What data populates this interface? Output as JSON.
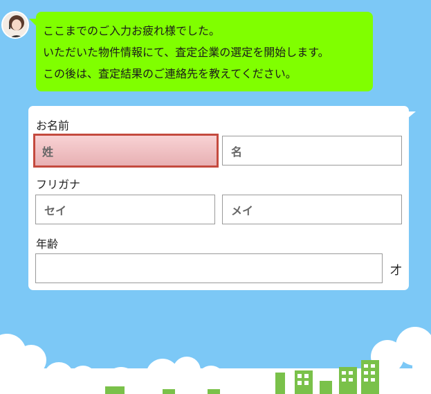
{
  "chat": {
    "lines": [
      "ここまでのご入力お疲れ様でした。",
      "いただいた物件情報にて、査定企業の選定を開始します。",
      "この後は、査定結果のご連絡先を教えてください。"
    ]
  },
  "form": {
    "name": {
      "label": "お名前",
      "last_placeholder": "姓",
      "first_placeholder": "名"
    },
    "furigana": {
      "label": "フリガナ",
      "last_placeholder": "セイ",
      "first_placeholder": "メイ"
    },
    "age": {
      "label": "年齢",
      "unit": "才"
    }
  },
  "colors": {
    "background": "#7cc8f6",
    "bubble": "#80ff00",
    "active_field_border": "#c44a3e",
    "building": "#7ac14a"
  }
}
